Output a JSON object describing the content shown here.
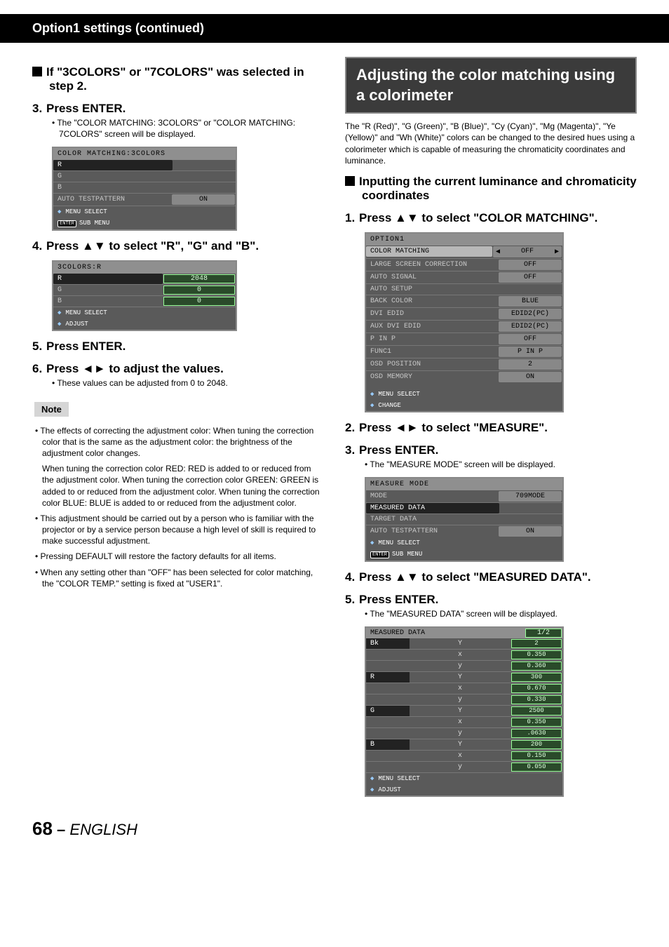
{
  "header": "Option1 settings (continued)",
  "left": {
    "sub1_title": "If \"3COLORS\" or \"7COLORS\" was selected in step 2.",
    "step3": "Press ENTER.",
    "step3_bullet": "The \"COLOR MATCHING: 3COLORS\" or \"COLOR MATCHING: 7COLORS\" screen will be displayed.",
    "panel1": {
      "title": "COLOR MATCHING:3COLORS",
      "rows": [
        {
          "label": "R",
          "value": ""
        },
        {
          "label": "G",
          "value": ""
        },
        {
          "label": "B",
          "value": ""
        },
        {
          "label": "AUTO TESTPATTERN",
          "value": "ON"
        }
      ],
      "foot1": "MENU SELECT",
      "foot2": "SUB MENU"
    },
    "step4": "Press ▲▼ to select \"R\", \"G\" and \"B\".",
    "panel2": {
      "title": "3COLORS:R",
      "rows": [
        {
          "label": "R",
          "value": "2048"
        },
        {
          "label": "G",
          "value": "0"
        },
        {
          "label": "B",
          "value": "0"
        }
      ],
      "foot1": "MENU SELECT",
      "foot2": "ADJUST"
    },
    "step5": "Press ENTER.",
    "step6": "Press ◄► to adjust the values.",
    "step6_bullet": "These values can be adjusted from 0 to 2048.",
    "note_label": "Note",
    "notes": [
      "The effects of correcting the adjustment color: When tuning the correction color that is the same as the adjustment color: the brightness of the adjustment color changes.",
      "__CONT__When tuning the correction color RED: RED is added to or reduced from the adjustment color. When tuning the correction color GREEN: GREEN is added to or reduced from the adjustment color. When tuning the correction color BLUE: BLUE is added to or reduced from the adjustment color.",
      "This adjustment should be carried out by a person who is familiar with the projector or by a service person because a high level of skill is required to make successful adjustment.",
      "Pressing DEFAULT will restore the factory defaults for all items.",
      "When any setting other than \"OFF\" has been selected for color matching, the \"COLOR TEMP.\" setting is fixed at \"USER1\"."
    ]
  },
  "right": {
    "title": "Adjusting the color matching using a colorimeter",
    "intro": "The \"R (Red)\", \"G (Green)\", \"B (Blue)\", \"Cy (Cyan)\", \"Mg (Magenta)\", \"Ye (Yellow)\" and \"Wh (White)\" colors can be changed to the desired hues using a colorimeter which is capable of measuring the chromaticity coordinates and luminance.",
    "sub_title": "Inputting the current luminance and chromaticity coordinates",
    "step1": "Press ▲▼ to select \"COLOR MATCHING\".",
    "panel_option1": {
      "title": "OPTION1",
      "rows": [
        {
          "label": "COLOR MATCHING",
          "value": "OFF",
          "sel": true
        },
        {
          "label": "LARGE SCREEN CORRECTION",
          "value": "OFF"
        },
        {
          "label": "AUTO SIGNAL",
          "value": "OFF"
        },
        {
          "label": "AUTO SETUP",
          "value": ""
        },
        {
          "label": "BACK COLOR",
          "value": "BLUE"
        },
        {
          "label": "DVI EDID",
          "value": "EDID2(PC)"
        },
        {
          "label": "AUX DVI EDID",
          "value": "EDID2(PC)"
        },
        {
          "label": "P IN P",
          "value": "OFF"
        },
        {
          "label": "FUNC1",
          "value": "P IN P"
        },
        {
          "label": "OSD POSITION",
          "value": "2"
        },
        {
          "label": "OSD MEMORY",
          "value": "ON"
        }
      ],
      "foot1": "MENU SELECT",
      "foot2": "CHANGE"
    },
    "step2": "Press ◄► to select \"MEASURE\".",
    "step3": "Press ENTER.",
    "step3_bullet": "The \"MEASURE MODE\" screen will be displayed.",
    "panel_measure": {
      "title": "MEASURE MODE",
      "rows": [
        {
          "label": "MODE",
          "value": "709MODE",
          "sel": true
        },
        {
          "label": "MEASURED DATA",
          "value": ""
        },
        {
          "label": "TARGET DATA",
          "value": ""
        },
        {
          "label": "AUTO TESTPATTERN",
          "value": "ON"
        }
      ],
      "foot1": "MENU SELECT",
      "foot2": "SUB MENU"
    },
    "step4": "Press ▲▼ to select \"MEASURED DATA\".",
    "step5": "Press ENTER.",
    "step5_bullet": "The \"MEASURED DATA\" screen will be displayed.",
    "panel_data": {
      "title": "MEASURED DATA",
      "page": "1/2",
      "groups": [
        {
          "head": "Bk",
          "rows": [
            [
              "Y",
              "2"
            ],
            [
              "x",
              "0.350"
            ],
            [
              "y",
              "0.360"
            ]
          ]
        },
        {
          "head": "R",
          "rows": [
            [
              "Y",
              "300"
            ],
            [
              "x",
              "0.670"
            ],
            [
              "y",
              "0.330"
            ]
          ]
        },
        {
          "head": "G",
          "rows": [
            [
              "Y",
              "2500"
            ],
            [
              "x",
              "0.350"
            ],
            [
              "y",
              ".0630"
            ]
          ]
        },
        {
          "head": "B",
          "rows": [
            [
              "Y",
              "200"
            ],
            [
              "x",
              "0.150"
            ],
            [
              "y",
              "0.050"
            ]
          ]
        }
      ],
      "foot1": "MENU SELECT",
      "foot2": "ADJUST"
    }
  },
  "footer": {
    "page": "68",
    "sep": " – ",
    "lang": "ENGLISH"
  }
}
